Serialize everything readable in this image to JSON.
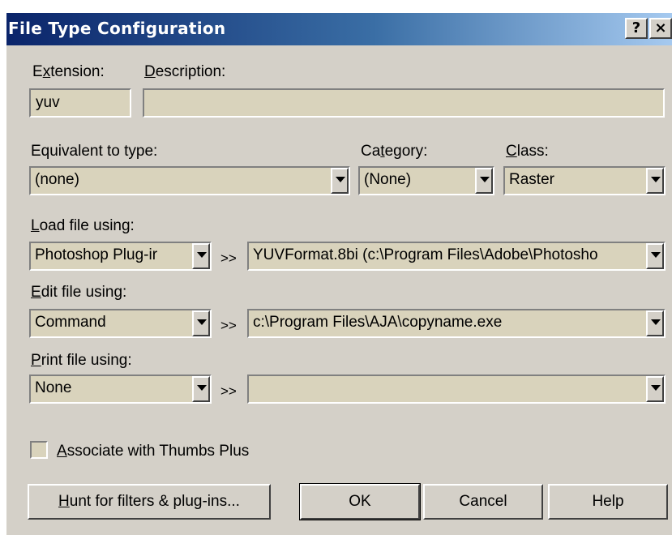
{
  "window": {
    "title": "File Type Configuration",
    "help_button": "?",
    "close_button": "×"
  },
  "extension": {
    "label_pre": "E",
    "label_key": "x",
    "label_post": "tension:",
    "value": "yuv"
  },
  "description": {
    "label_key": "D",
    "label_post": "escription:",
    "value": ""
  },
  "equivalent": {
    "label": "Equivalent to type:",
    "value": "(none)"
  },
  "category": {
    "label_pre": "Ca",
    "label_key": "t",
    "label_post": "egory:",
    "value": "(None)"
  },
  "class": {
    "label_key": "C",
    "label_post": "lass:",
    "value": "Raster"
  },
  "load": {
    "label_key": "L",
    "label_post": "oad file using:",
    "method": "Photoshop Plug-ir",
    "separator": ">>",
    "target": "YUVFormat.8bi (c:\\Program Files\\Adobe\\Photosho"
  },
  "edit": {
    "label_key": "E",
    "label_post": "dit file using:",
    "method": "Command",
    "separator": ">>",
    "target": "c:\\Program Files\\AJA\\copyname.exe"
  },
  "print": {
    "label_key": "P",
    "label_post": "rint file using:",
    "method": "None",
    "separator": ">>",
    "target": ""
  },
  "associate": {
    "label_key": "A",
    "label_post": "ssociate with Thumbs Plus",
    "checked": false
  },
  "buttons": {
    "hunt_key": "H",
    "hunt_post": "unt for filters & plug-ins...",
    "ok": "OK",
    "cancel": "Cancel",
    "help": "Help"
  },
  "colors": {
    "dialog_bg": "#d4d0c8",
    "field_bg": "#d9d3bc",
    "title_start": "#0a246a",
    "title_end": "#a6caf0"
  }
}
